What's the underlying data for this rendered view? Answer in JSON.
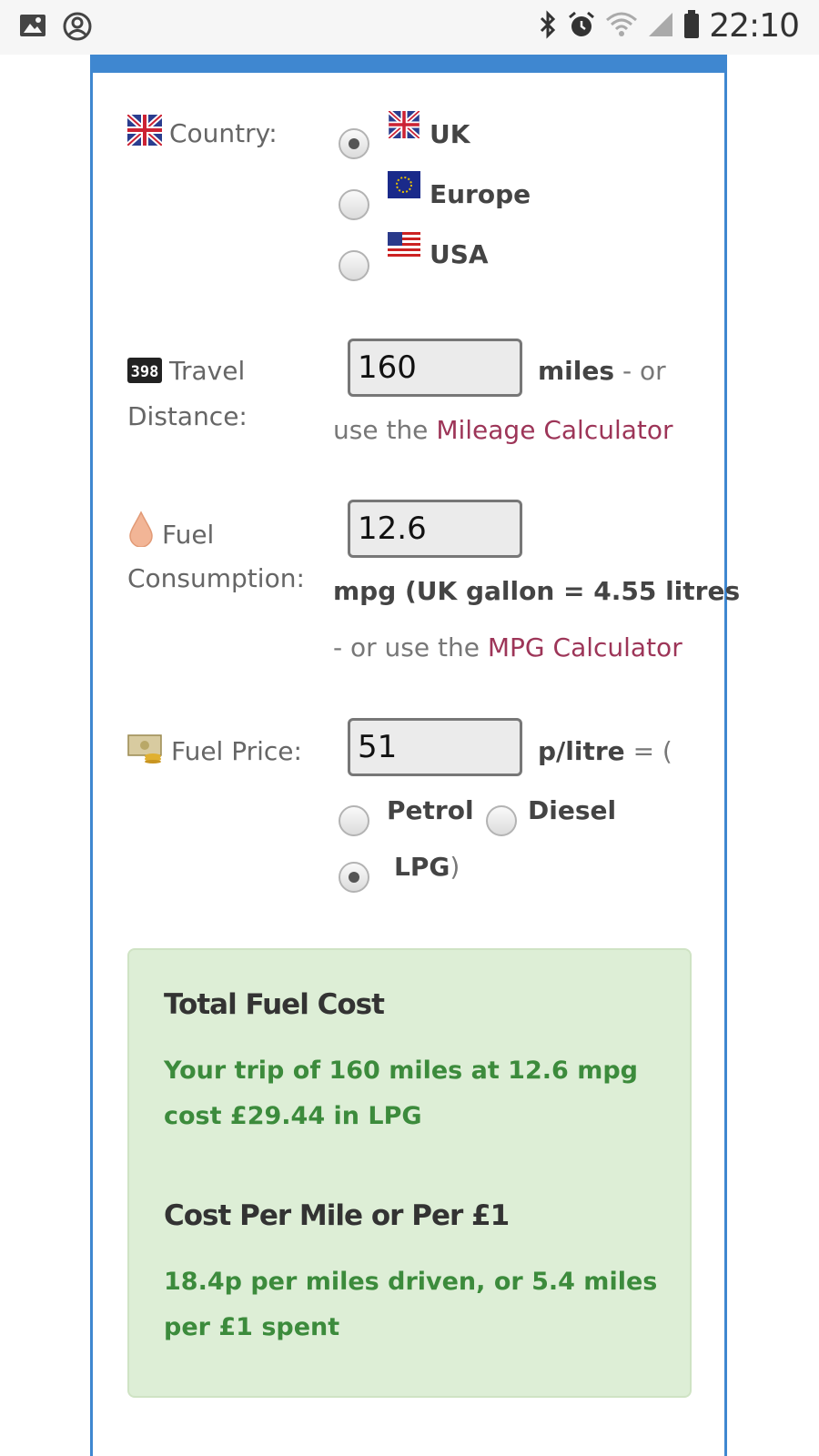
{
  "status_bar": {
    "time": "22:10",
    "icons": [
      "image-icon",
      "account-icon",
      "bluetooth-icon",
      "alarm-icon",
      "wifi-icon",
      "signal-icon",
      "battery-icon"
    ]
  },
  "country": {
    "label": "Country:",
    "options": [
      {
        "label": "UK",
        "selected": true
      },
      {
        "label": "Europe",
        "selected": false
      },
      {
        "label": "USA",
        "selected": false
      }
    ]
  },
  "distance": {
    "label_line1": "Travel",
    "label_line2": "Distance:",
    "value": "160",
    "unit": "miles",
    "or_text": "- or",
    "use_the": "use the",
    "link": "Mileage Calculator"
  },
  "consumption": {
    "label_line1": "Fuel",
    "label_line2": "Consumption:",
    "value": "12.6",
    "unit_text": "mpg (UK gallon = 4.55 litres",
    "or_use_the": "- or use the",
    "link": "MPG Calculator"
  },
  "price": {
    "label": "Fuel Price:",
    "value": "51",
    "unit": "p/litre",
    "eq_open": "= (",
    "fuel_types": [
      {
        "label": "Petrol",
        "selected": false
      },
      {
        "label": "Diesel",
        "selected": false
      },
      {
        "label": "LPG",
        "selected": true
      }
    ],
    "close_paren": ")"
  },
  "result": {
    "total_heading": "Total Fuel Cost",
    "total_line1": "Your trip of 160 miles at 12.6 mpg",
    "total_line2": "cost £29.44 in LPG",
    "per_heading": "Cost Per Mile or Per £1",
    "per_line1": "18.4p per miles driven, or 5.4 miles",
    "per_line2": "per £1 spent"
  },
  "colors": {
    "frame_blue": "#3f87d0",
    "link": "#9d3558",
    "result_bg": "#ddeed6",
    "result_text": "#3c8b3c"
  }
}
